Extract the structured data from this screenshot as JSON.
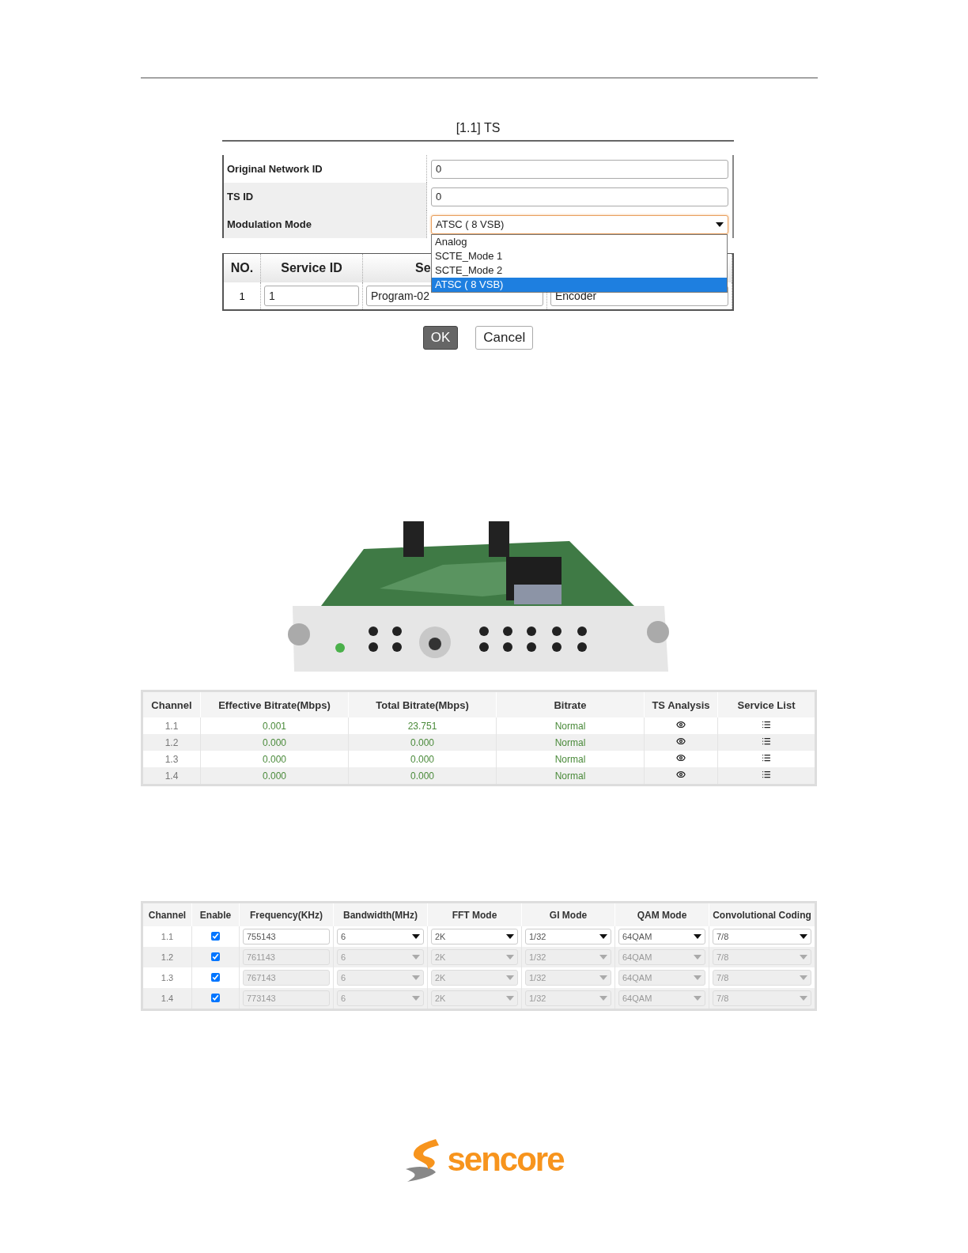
{
  "dialog": {
    "title": "[1.1] TS",
    "fields": [
      {
        "kind": "text",
        "label": "Original Network ID",
        "value": "0"
      },
      {
        "kind": "text",
        "label": "TS ID",
        "value": "0"
      },
      {
        "kind": "select",
        "label": "Modulation Mode",
        "value": "ATSC ( 8 VSB)",
        "expanded": true,
        "options": [
          {
            "label": "Analog",
            "selected": false
          },
          {
            "label": "SCTE_Mode 1",
            "selected": false
          },
          {
            "label": "SCTE_Mode 2",
            "selected": false
          },
          {
            "label": "ATSC ( 8 VSB)",
            "selected": true
          }
        ]
      }
    ],
    "services": {
      "columns": [
        "NO.",
        "Service ID",
        "Se"
      ],
      "rows": [
        {
          "no": "1",
          "service_id": "1",
          "name": "Program-02",
          "column_4": "Encoder"
        }
      ]
    },
    "buttons": [
      {
        "label": "OK",
        "primary": true
      },
      {
        "label": "Cancel",
        "primary": false
      }
    ]
  },
  "status_table": {
    "columns": [
      "Channel",
      "Effective Bitrate(Mbps)",
      "Total Bitrate(Mbps)",
      "Bitrate",
      "TS Analysis",
      "Service List"
    ],
    "rows": [
      {
        "channel": "1.1",
        "effective": "0.001",
        "total": "23.751",
        "bitrate": "Normal"
      },
      {
        "channel": "1.2",
        "effective": "0.000",
        "total": "0.000",
        "bitrate": "Normal"
      },
      {
        "channel": "1.3",
        "effective": "0.000",
        "total": "0.000",
        "bitrate": "Normal"
      },
      {
        "channel": "1.4",
        "effective": "0.000",
        "total": "0.000",
        "bitrate": "Normal"
      }
    ]
  },
  "config_table": {
    "columns": [
      "Channel",
      "Enable",
      "Frequency(KHz)",
      "Bandwidth(MHz)",
      "FFT Mode",
      "GI Mode",
      "QAM Mode",
      "Convolutional Coding"
    ],
    "rows": [
      {
        "channel": "1.1",
        "enabled": true,
        "disabled": false,
        "frequency": "755143",
        "bandwidth": "6",
        "fft": "2K",
        "gi": "1/32",
        "qam": "64QAM",
        "coding": "7/8"
      },
      {
        "channel": "1.2",
        "enabled": true,
        "disabled": true,
        "frequency": "761143",
        "bandwidth": "6",
        "fft": "2K",
        "gi": "1/32",
        "qam": "64QAM",
        "coding": "7/8"
      },
      {
        "channel": "1.3",
        "enabled": true,
        "disabled": true,
        "frequency": "767143",
        "bandwidth": "6",
        "fft": "2K",
        "gi": "1/32",
        "qam": "64QAM",
        "coding": "7/8"
      },
      {
        "channel": "1.4",
        "enabled": true,
        "disabled": true,
        "frequency": "773143",
        "bandwidth": "6",
        "fft": "2K",
        "gi": "1/32",
        "qam": "64QAM",
        "coding": "7/8"
      }
    ]
  },
  "logo": {
    "text": "sencore"
  }
}
